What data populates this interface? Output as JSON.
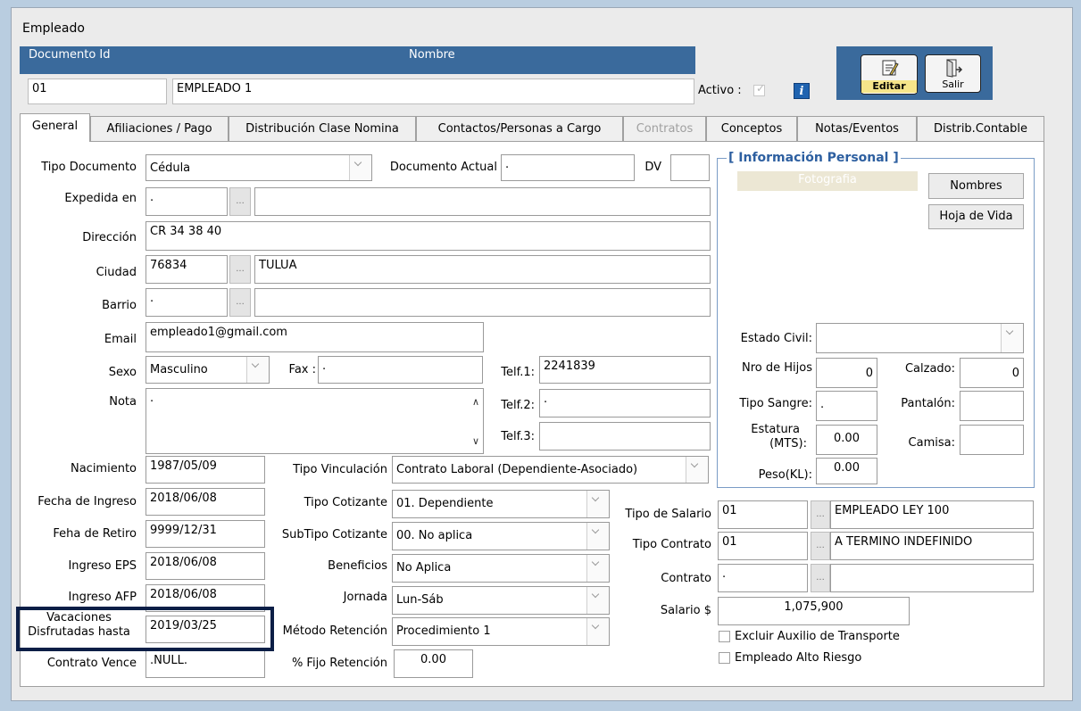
{
  "window": {
    "title": "Empleado"
  },
  "header": {
    "documento_label": "Documento Id",
    "nombre_label": "Nombre",
    "documento_value": "01",
    "nombre_value": "EMPLEADO 1",
    "activo_label": "Activo :",
    "activo_checked": true
  },
  "toolbar": {
    "editar_label": "Editar",
    "salir_label": "Salir"
  },
  "tabs": [
    {
      "label": "General",
      "active": true
    },
    {
      "label": "Afiliaciones / Pago"
    },
    {
      "label": "Distribución Clase Nomina"
    },
    {
      "label": "Contactos/Personas a Cargo"
    },
    {
      "label": "Contratos",
      "disabled": true
    },
    {
      "label": "Conceptos"
    },
    {
      "label": "Notas/Eventos"
    },
    {
      "label": "Distrib.Contable"
    }
  ],
  "general": {
    "tipo_documento": {
      "label": "Tipo Documento",
      "value": "Cédula"
    },
    "documento_actual": {
      "label": "Documento Actual",
      "value": "."
    },
    "dv": {
      "label": "DV",
      "value": ""
    },
    "expedida_en": {
      "label": "Expedida en",
      "code": ".",
      "name": ""
    },
    "direccion": {
      "label": "Dirección",
      "value": "CR 34 38 40"
    },
    "ciudad": {
      "label": "Ciudad",
      "code": "76834",
      "name": "TULUA"
    },
    "barrio": {
      "label": "Barrio",
      "code": ".",
      "name": ""
    },
    "email": {
      "label": "Email",
      "value": "empleado1@gmail.com"
    },
    "sexo": {
      "label": "Sexo",
      "value": "Masculino"
    },
    "fax": {
      "label": "Fax :",
      "value": "."
    },
    "telf1": {
      "label": "Telf.1:",
      "value": "2241839"
    },
    "telf2": {
      "label": "Telf.2:",
      "value": "."
    },
    "telf3": {
      "label": "Telf.3:",
      "value": ""
    },
    "nota": {
      "label": "Nota",
      "value": "."
    },
    "nacimiento": {
      "label": "Nacimiento",
      "value": "1987/05/09"
    },
    "fecha_ingreso": {
      "label": "Fecha de Ingreso",
      "value": "2018/06/08"
    },
    "fecha_retiro": {
      "label": "Feha de Retiro",
      "value": "9999/12/31"
    },
    "ingreso_eps": {
      "label": "Ingreso EPS",
      "value": "2018/06/08"
    },
    "ingreso_afp": {
      "label": "Ingreso AFP",
      "value": "2018/06/08"
    },
    "vacaciones": {
      "label_line1": "Vacaciones",
      "label_line2": "Disfrutadas hasta",
      "value": "2019/03/25"
    },
    "contrato_vence": {
      "label": "Contrato Vence",
      "value": ".NULL."
    },
    "tipo_vinculacion": {
      "label": "Tipo Vinculación",
      "value": "Contrato Laboral (Dependiente-Asociado)"
    },
    "tipo_cotizante": {
      "label": "Tipo Cotizante",
      "value": "01. Dependiente"
    },
    "subtipo_cotizante": {
      "label": "SubTipo Cotizante",
      "value": "00. No aplica"
    },
    "beneficios": {
      "label": "Beneficios",
      "value": "No Aplica"
    },
    "jornada": {
      "label": "Jornada",
      "value": "Lun-Sáb"
    },
    "metodo_retencion": {
      "label": "Método Retención",
      "value": "Procedimiento 1"
    },
    "fijo_retencion": {
      "label": "% Fijo Retención",
      "value": "0.00"
    },
    "tipo_salario": {
      "label": "Tipo de Salario",
      "code": "01",
      "name": "EMPLEADO LEY 100"
    },
    "tipo_contrato": {
      "label": "Tipo Contrato",
      "code": "01",
      "name": "A TERMINO INDEFINIDO"
    },
    "contrato": {
      "label": "Contrato",
      "code": ".",
      "name": ""
    },
    "salario": {
      "label": "Salario $",
      "value": "1,075,900"
    },
    "excluir_auxilio": {
      "label": "Excluir Auxilio de Transporte",
      "checked": false
    },
    "alto_riesgo": {
      "label": "Empleado Alto Riesgo",
      "checked": false
    }
  },
  "info_personal": {
    "title": "[ Información Personal ]",
    "fotografia_label": "Fotografia",
    "nombres_button": "Nombres",
    "hoja_vida_button": "Hoja de Vida",
    "estado_civil": {
      "label": "Estado Civil:",
      "value": ""
    },
    "nro_hijos": {
      "label": "Nro de Hijos",
      "value": "0"
    },
    "calzado": {
      "label": "Calzado:",
      "value": "0"
    },
    "tipo_sangre": {
      "label": "Tipo Sangre:",
      "value": "."
    },
    "pantalon": {
      "label": "Pantalón:",
      "value": ""
    },
    "estatura": {
      "label_line1": "Estatura",
      "label_line2": "(MTS):",
      "value": "0.00"
    },
    "camisa": {
      "label": "Camisa:",
      "value": ""
    },
    "peso": {
      "label": "Peso(KL):",
      "value": "0.00"
    }
  },
  "colors": {
    "header_bg": "#3a6a9c",
    "highlight_border": "#0b1e46",
    "window_bg": "#ebebeb",
    "panel_bg": "#ffffff"
  }
}
